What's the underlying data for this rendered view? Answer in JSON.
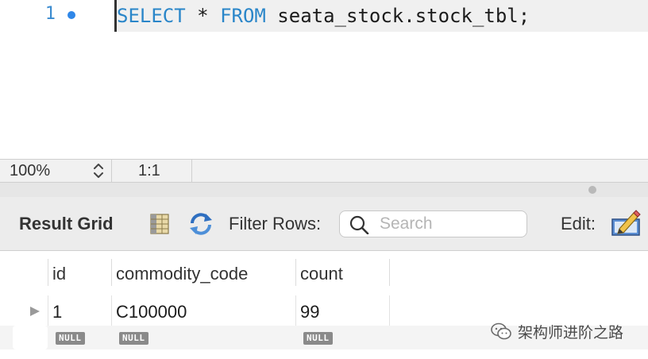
{
  "editor": {
    "line_number": "1",
    "query": {
      "kw_select": "SELECT",
      "star": " * ",
      "kw_from": "FROM",
      "rest": " seata_stock.stock_tbl;"
    }
  },
  "status_bar": {
    "zoom": "100%",
    "cursor_position": "1:1"
  },
  "result_toolbar": {
    "title": "Result Grid",
    "filter_label": "Filter Rows:",
    "search_placeholder": "Search",
    "search_value": "",
    "edit_label": "Edit:"
  },
  "grid": {
    "columns": [
      "id",
      "commodity_code",
      "count"
    ],
    "rows": [
      [
        "1",
        "C100000",
        "99"
      ]
    ],
    "new_row": [
      "NULL",
      "NULL",
      "NULL"
    ]
  },
  "watermark": {
    "text": "架构师进阶之路"
  },
  "colors": {
    "keyword": "#2a86c9",
    "line_number": "#3a8bd0",
    "breakpoint": "#2f87e8",
    "null_badge": "#8a8a8a"
  }
}
